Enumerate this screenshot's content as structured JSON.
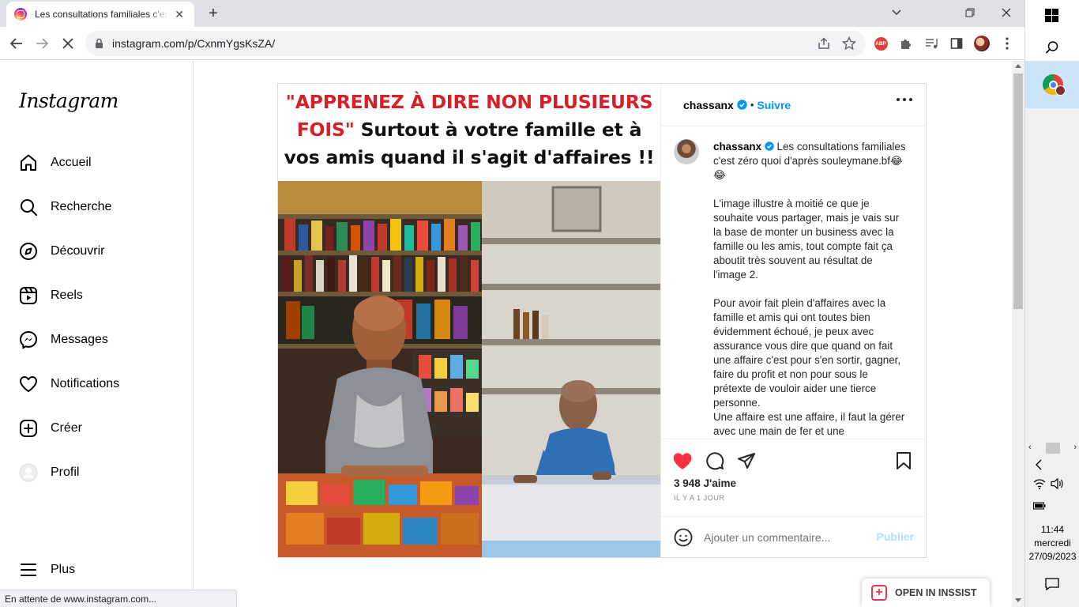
{
  "browser": {
    "tab_title": "Les consultations familiales c'est zéro quoi d'après souleymane.bf",
    "url": "instagram.com/p/CxnmYgsKsZA/",
    "status_text": "En attente de www.instagram.com..."
  },
  "sidebar": {
    "logo": "Instagram",
    "items": [
      {
        "label": "Accueil",
        "icon": "home-icon"
      },
      {
        "label": "Recherche",
        "icon": "search-icon"
      },
      {
        "label": "Découvrir",
        "icon": "compass-icon"
      },
      {
        "label": "Reels",
        "icon": "reels-icon"
      },
      {
        "label": "Messages",
        "icon": "messenger-icon"
      },
      {
        "label": "Notifications",
        "icon": "heart-icon"
      },
      {
        "label": "Créer",
        "icon": "plus-square-icon"
      },
      {
        "label": "Profil",
        "icon": "avatar-icon"
      }
    ],
    "more_label": "Plus"
  },
  "post": {
    "image_caption": {
      "red": "\"APPRENEZ À DIRE NON PLUSIEURS",
      "red2": "FOIS\"",
      "black1": " Surtout à votre famille et à",
      "black2": "vos amis quand il s'agit d'affaires !!"
    },
    "author": "chassanx",
    "dot": "•",
    "follow_label": "Suivre",
    "caption": {
      "first_line": "Les consultations familiales c'est zéro quoi d'après souleymane.bf😂😂",
      "p2": "L'image illustre à moitié ce que je souhaite vous partager, mais je vais sur la base de monter un business avec la famille ou les amis, tout compte fait ça aboutit très souvent au résultat de l'image 2.",
      "p3": "Pour avoir fait plein d'affaires avec la famille et amis qui ont toutes bien évidemment échoué, je peux avec assurance vous dire que quand on fait une affaire c'est pour s'en sortir, gagner, faire du profit et non pour sous le prétexte de vouloir aider une tierce personne.",
      "p4": "Une affaire est une affaire, il faut la gérer avec une main de fer et une"
    },
    "likes": "3 948 J'aime",
    "time": "IL Y A 1 JOUR",
    "comment_placeholder": "Ajouter un commentaire...",
    "publish_label": "Publier",
    "liked": true
  },
  "insist": {
    "label": "OPEN IN INSSIST"
  },
  "taskbar": {
    "time": "11:44",
    "day": "mercredi",
    "date": "27/09/2023"
  },
  "colors": {
    "accent_blue": "#0095f6",
    "like_red": "#ff3040",
    "caption_red": "#d61f26"
  }
}
